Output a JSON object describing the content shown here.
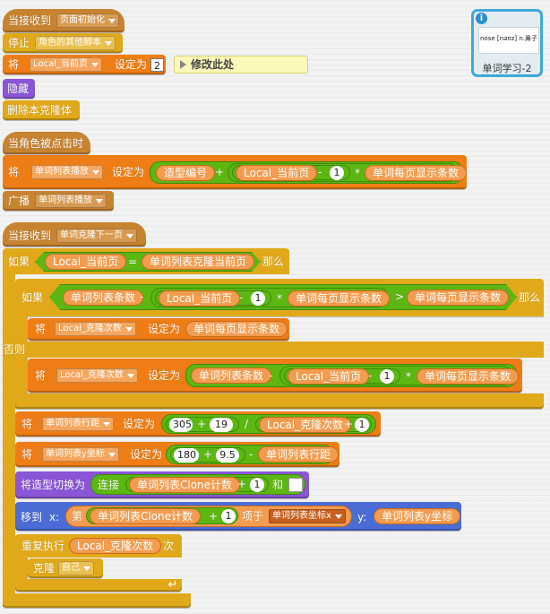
{
  "script1": {
    "hat_label": "当接收到",
    "hat_msg": "页面初始化",
    "stop_label": "停止",
    "stop_opt": "角色的其他脚本",
    "set_label": "将",
    "set_var": "Local_当前页",
    "set_to": "设定为",
    "set_value": "2",
    "comment": "修改此处",
    "hide": "隐藏",
    "delete_clone": "删除本克隆体"
  },
  "script2": {
    "hat": "当角色被点击时",
    "set_label": "将",
    "set_var": "单词列表播放",
    "set_to": "设定为",
    "costume_no": "造型编号",
    "plus": "+",
    "local_page": "Local_当前页",
    "minus": "-",
    "one": "1",
    "times": "*",
    "per_page": "单词每页显示条数",
    "broadcast_label": "广播",
    "broadcast_msg": "单词列表播放"
  },
  "script3": {
    "hat_label": "当接收到",
    "hat_msg": "单词克隆下一页",
    "if_label": "如果",
    "local_page": "Local_当前页",
    "eq": "=",
    "clone_page": "单词列表克隆当前页",
    "then": "那么",
    "inner_if": "如果",
    "list_count": "单词列表条数",
    "minus": "-",
    "one": "1",
    "times": "*",
    "per_page": "单词每页显示条数",
    "gt": ">",
    "then2": "那么",
    "set1_label": "将",
    "clone_times": "Local_克隆次数",
    "set_to": "设定为",
    "else": "否则",
    "row_gap_var": "单词列表行距",
    "x305": "305",
    "x19": "19",
    "div": "/",
    "ycoord_var": "单词列表y坐标",
    "y180": "180",
    "y95": "9.5",
    "switch_costume": "将造型切换为",
    "join": "连接",
    "clone_count": "单词列表Clone计数",
    "and": "和",
    "goto": "移到",
    "x_label": "x:",
    "item_label": "第",
    "item_of": "项于",
    "x_list": "单词列表坐标x",
    "y_label": "y:",
    "repeat": "重复执行",
    "times_label": "次",
    "clone": "克隆",
    "self": "自己"
  },
  "sprite": {
    "name": "单词学习-2",
    "thumb_text": "nose [nəʊz] n.鼻子",
    "info_icon": "info-icon"
  }
}
